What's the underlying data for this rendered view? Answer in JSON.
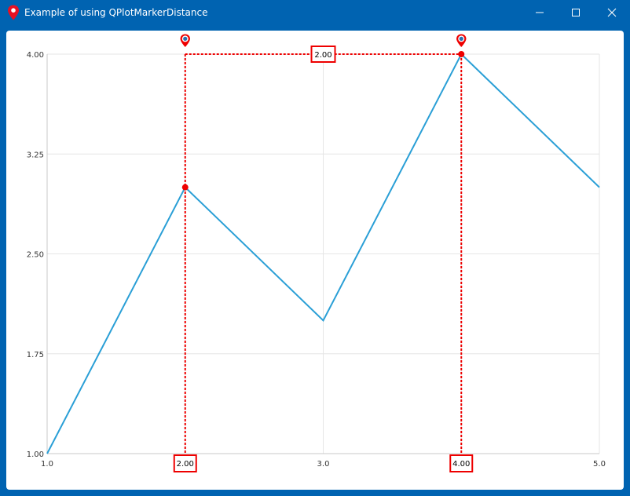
{
  "window": {
    "title": "Example of using QPlotMarkerDistance",
    "icon": "map-pin-icon",
    "controls": [
      "minimize-icon",
      "maximize-icon",
      "close-icon"
    ]
  },
  "colors": {
    "titlebar": "#0063b1",
    "series": "#2a9fd6",
    "marker": "#ee0000",
    "grid": "#e6e6e6"
  },
  "chart_data": {
    "type": "line",
    "x": [
      1.0,
      2.0,
      3.0,
      4.0,
      5.0
    ],
    "y": [
      1.0,
      3.0,
      2.0,
      4.0,
      3.0
    ],
    "xlim": [
      1.0,
      5.0
    ],
    "ylim": [
      1.0,
      4.0
    ],
    "x_ticks": [
      "1.0",
      "2.00",
      "3.0",
      "4.00",
      "5.0"
    ],
    "y_ticks": [
      "1.00",
      "1.75",
      "2.50",
      "3.25",
      "4.00"
    ],
    "grid": true,
    "markers": [
      {
        "x": 2.0,
        "y": 3.0,
        "label": "2.00"
      },
      {
        "x": 4.0,
        "y": 4.0,
        "label": "4.00"
      }
    ],
    "distance": {
      "label": "2.00",
      "y": 4.0
    }
  }
}
